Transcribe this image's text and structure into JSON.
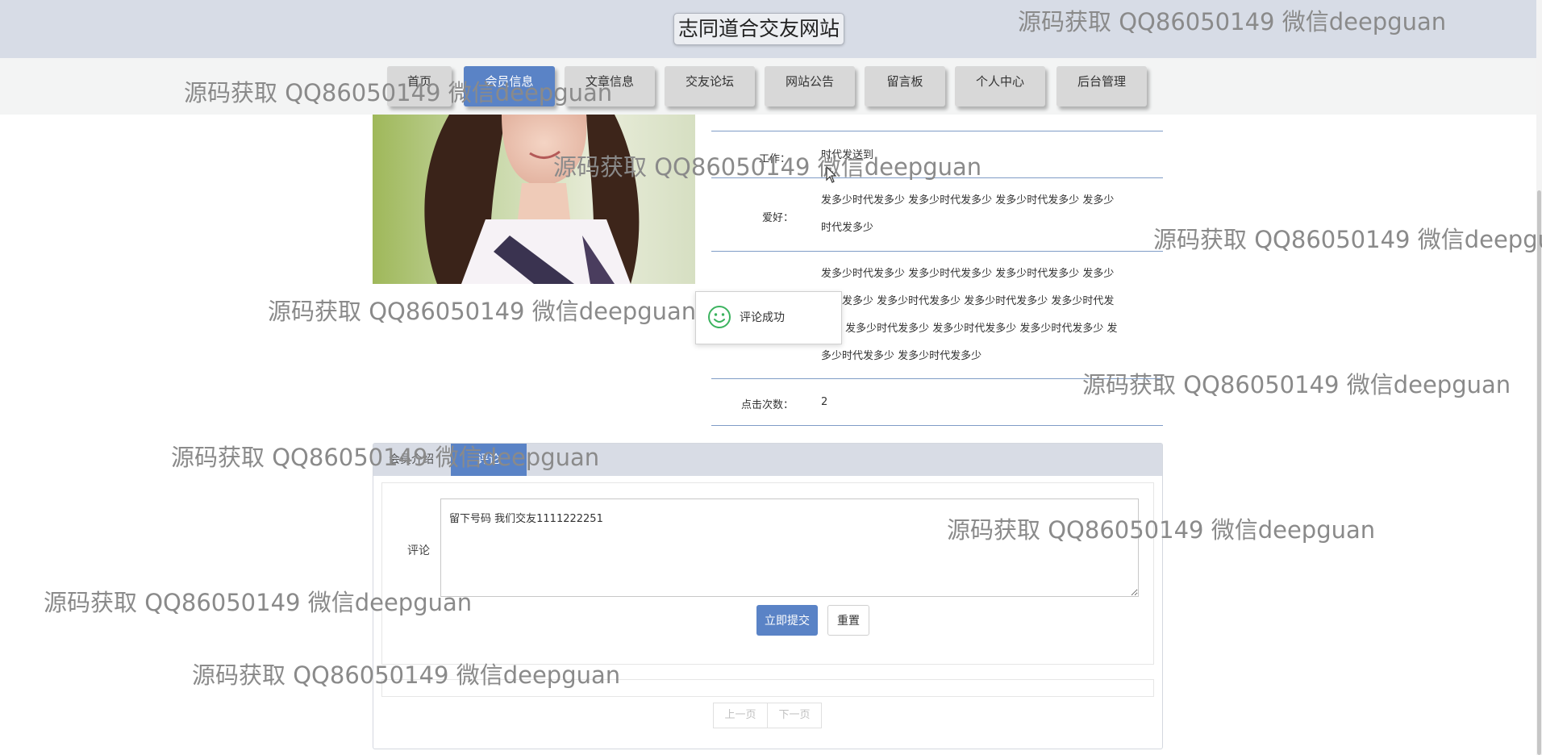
{
  "site": {
    "title": "志同道合交友网站"
  },
  "nav": {
    "items": [
      {
        "label": "首页"
      },
      {
        "label": "会员信息"
      },
      {
        "label": "文章信息"
      },
      {
        "label": "交友论坛"
      },
      {
        "label": "网站公告"
      },
      {
        "label": "留言板"
      },
      {
        "label": "个人中心"
      },
      {
        "label": "后台管理"
      }
    ],
    "active_index": 1
  },
  "profile": {
    "work_label": "工作：",
    "work_value": "时代发送到",
    "hobby_label": "爱好：",
    "hobby_value_line1": "发多少时代发多少 发多少时代发多少 发多少时代发多少 发多少",
    "hobby_value_line2": "时代发多少",
    "intro_line1": "发多少时代发多少 发多少时代发多少 发多少时代发多少 发多少",
    "intro_line2": "时代发多少 发多少时代发多少 发多少时代发多少 发多少时代发",
    "intro_line3": "多少 发多少时代发多少 发多少时代发多少 发多少时代发多少 发",
    "intro_line4": "多少时代发多少 发多少时代发多少",
    "clicks_label": "点击次数：",
    "clicks_value": "2"
  },
  "toast": {
    "message": "评论成功",
    "icon": "smile-icon"
  },
  "comments": {
    "tab_intro": "会员介绍",
    "tab_comments": "评论",
    "field_label": "评论",
    "textarea_value": "留下号码 我们交友1111222251",
    "submit_label": "立即提交",
    "reset_label": "重置",
    "prev_page": "上一页",
    "next_page": "下一页"
  },
  "watermark": {
    "text": "源码获取 QQ86050149 微信deepguan"
  },
  "colors": {
    "accent": "#5a83c6",
    "header": "#d7dce6",
    "divider": "#7f9cc6",
    "toast_icon": "#3cb35f"
  }
}
